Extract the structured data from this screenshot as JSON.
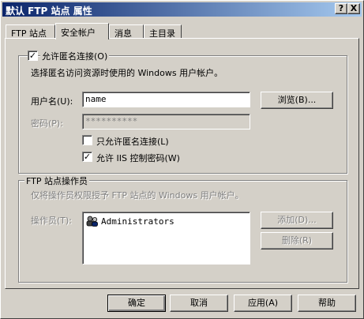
{
  "window": {
    "title": "默认 FTP 站点 属性",
    "help_btn": "?",
    "close_btn": "X"
  },
  "tabs": [
    "FTP 站点",
    "安全帐户",
    "消息",
    "主目录"
  ],
  "anon": {
    "checkbox_label": "允许匿名连接(O)",
    "description": "选择匿名访问资源时使用的 Windows 用户帐户。",
    "username_label": "用户名(U):",
    "username_value": "name",
    "browse_button": "浏览(B)...",
    "password_label": "密码(P):",
    "password_value": "**********",
    "only_anon_label": "只允许匿名连接(L)",
    "iis_password_label": "允许 IIS 控制密码(W)"
  },
  "operators": {
    "group_label": "FTP 站点操作员",
    "description": "仅将操作员权限授予 FTP 站点的 Windows 用户帐户。",
    "label": "操作员(T):",
    "items": [
      "Administrators"
    ],
    "add_button": "添加(D)...",
    "remove_button": "删除(R)"
  },
  "footer": {
    "ok": "确定",
    "cancel": "取消",
    "apply": "应用(A)",
    "help": "帮助"
  }
}
